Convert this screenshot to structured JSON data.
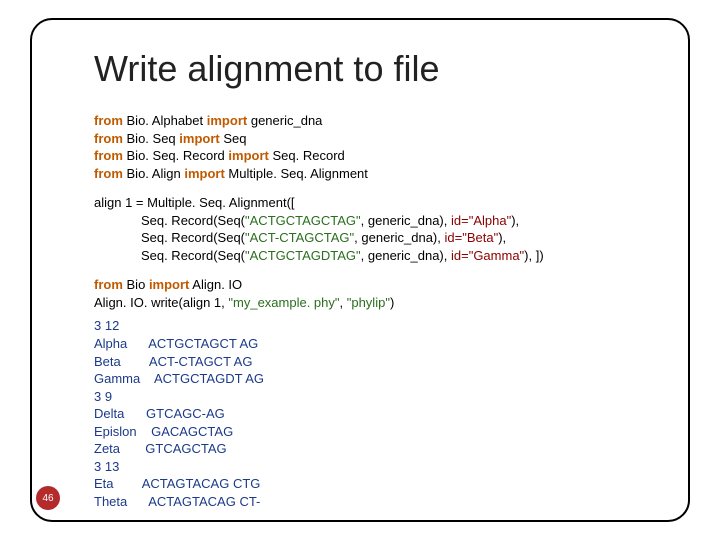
{
  "title": "Write alignment to file",
  "imports": [
    {
      "mod": "Bio. Alphabet",
      "names": "generic_dna"
    },
    {
      "mod": "Bio. Seq",
      "names": "Seq"
    },
    {
      "mod": "Bio. Seq. Record",
      "names": "Seq. Record"
    },
    {
      "mod": "Bio. Align",
      "names": "Multiple. Seq. Alignment"
    }
  ],
  "align_block": {
    "head": "align 1 = Multiple. Seq. Alignment([",
    "rows": [
      {
        "seq": "\"ACTGCTAGCTAG\"",
        "gen": ", generic_dna), ",
        "id": "id=\"Alpha\"",
        "tail": "),"
      },
      {
        "seq": "\"ACT-CTAGCTAG\"",
        "gen": ", generic_dna), ",
        "id": "id=\"Beta\"",
        "tail": "),"
      },
      {
        "seq": "\"ACTGCTAGDTAG\"",
        "gen": ", generic_dna), ",
        "id": "id=\"Gamma\"",
        "tail": "), ])"
      }
    ],
    "row_prefix": "             Seq. Record(Seq("
  },
  "io": {
    "from": "Bio",
    "imp": "Align. IO",
    "call_pre": "Align. IO. write(align 1, ",
    "file": "\"my_example. phy\"",
    "sep": ", ",
    "fmt": "\"phylip\"",
    "call_post": ")"
  },
  "output_lines": [
    "3 12",
    "Alpha      ACTGCTAGCT AG",
    "Beta        ACT-CTAGCT AG",
    "Gamma    ACTGCTAGDT AG",
    "3 9",
    "Delta      GTCAGC-AG",
    "Epislon    GACAGCTAG",
    "Zeta       GTCAGCTAG",
    "3 13",
    "Eta        ACTAGTACAG CTG",
    "Theta      ACTAGTACAG CT-"
  ],
  "page_number": "46",
  "kw": {
    "from": "from",
    "import": "import"
  }
}
